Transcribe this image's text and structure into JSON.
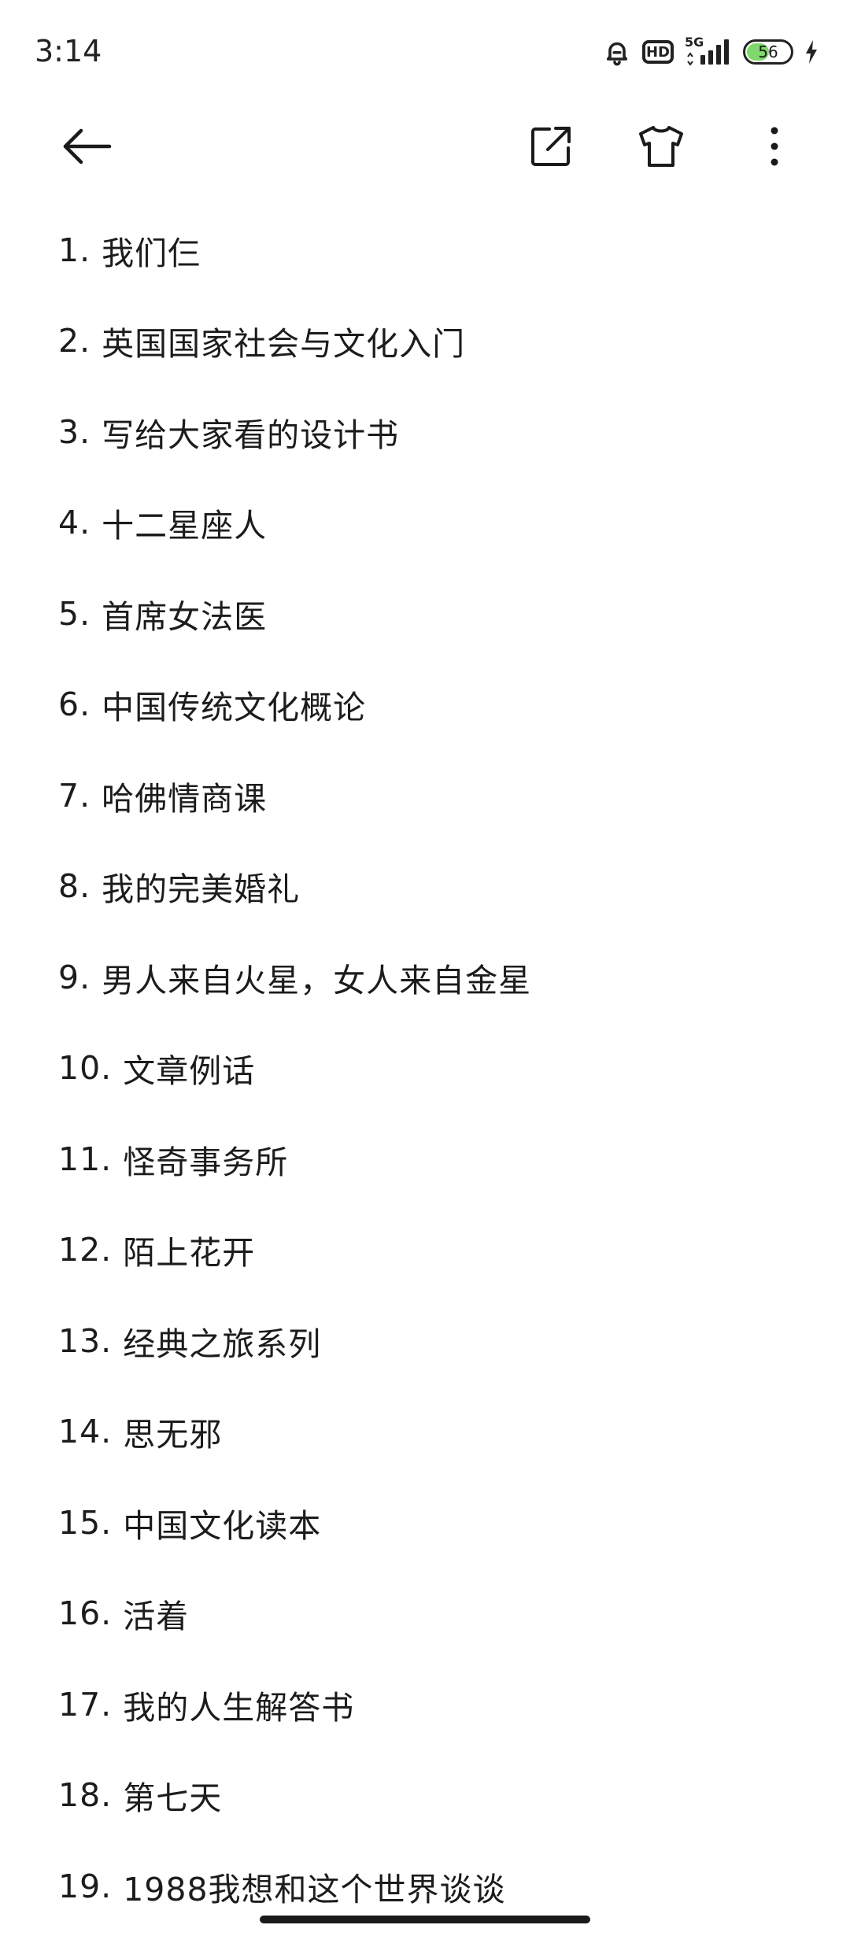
{
  "status_bar": {
    "time": "3:14",
    "network": "5G",
    "hd_label": "HD",
    "battery_level": "56",
    "battery_fraction": 0.56,
    "battery_color": "#7fd86b",
    "icons": [
      "alarm-icon",
      "hd-icon",
      "signal-icon",
      "battery-icon",
      "charging-icon"
    ]
  },
  "app_bar": {
    "icons": [
      "back-arrow-icon",
      "share-external-icon",
      "shirt-theme-icon",
      "more-vertical-icon"
    ]
  },
  "books": [
    {
      "num": "1.",
      "title": "我们仨"
    },
    {
      "num": "2.",
      "title": "英国国家社会与文化入门"
    },
    {
      "num": "3.",
      "title": "写给大家看的设计书"
    },
    {
      "num": "4.",
      "title": "十二星座人"
    },
    {
      "num": "5.",
      "title": "首席女法医"
    },
    {
      "num": "6.",
      "title": "中国传统文化概论"
    },
    {
      "num": "7.",
      "title": "哈佛情商课"
    },
    {
      "num": "8.",
      "title": "我的完美婚礼"
    },
    {
      "num": "9.",
      "title": "男人来自火星，女人来自金星"
    },
    {
      "num": "10.",
      "title": "文章例话"
    },
    {
      "num": "11.",
      "title": "怪奇事务所"
    },
    {
      "num": "12.",
      "title": "陌上花开"
    },
    {
      "num": "13.",
      "title": "经典之旅系列"
    },
    {
      "num": "14.",
      "title": "思无邪"
    },
    {
      "num": "15.",
      "title": "中国文化读本"
    },
    {
      "num": "16.",
      "title": "活着"
    },
    {
      "num": "17.",
      "title": "我的人生解答书"
    },
    {
      "num": "18.",
      "title": "第七天"
    },
    {
      "num": "19.",
      "title": "1988我想和这个世界谈谈"
    }
  ]
}
